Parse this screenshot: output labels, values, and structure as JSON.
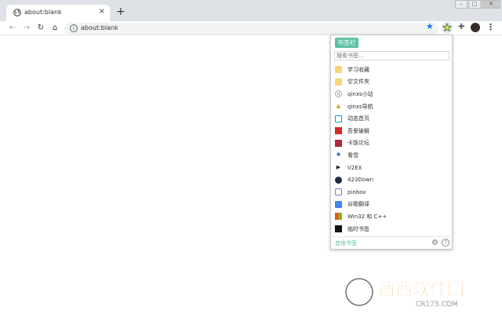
{
  "tab": {
    "title": "about:blank",
    "close": "×"
  },
  "newtab": "+",
  "window_buttons": [
    "–",
    "□",
    "✕"
  ],
  "nav": {
    "back": "←",
    "forward": "→",
    "reload": "↻",
    "home": "⌂"
  },
  "omnibox": {
    "info": "i",
    "url": "about:blank"
  },
  "toolbar_icons": {
    "star": "★",
    "puzzle": "✚",
    "menu": "⋮"
  },
  "popup": {
    "header": "书签栏",
    "search_placeholder": "搜索书签...",
    "items": [
      {
        "label": "学习收藏",
        "icon": "folder-icon"
      },
      {
        "label": "空文件夹",
        "icon": "folder-icon"
      },
      {
        "label": "qinxs小站",
        "icon": "q-site-icon"
      },
      {
        "label": "qinxs导航",
        "icon": "rocket-icon"
      },
      {
        "label": "动态首页",
        "icon": "tv-icon"
      },
      {
        "label": "吾爱破解",
        "icon": "grid-icon"
      },
      {
        "label": "卡饭论坛",
        "icon": "kafan-icon"
      },
      {
        "label": "看雪",
        "icon": "snowflake-icon"
      },
      {
        "label": "V2EX",
        "icon": "v2ex-icon"
      },
      {
        "label": "423Down",
        "icon": "down-icon"
      },
      {
        "label": "pinbox",
        "icon": "pinbox-icon"
      },
      {
        "label": "谷歌翻译",
        "icon": "translate-icon"
      },
      {
        "label": "Win32 和 C++",
        "icon": "windows-icon"
      },
      {
        "label": "临时书签",
        "icon": "bookmark-icon"
      }
    ],
    "footer": {
      "other": "其他书签",
      "gear": "⚙",
      "help": "?"
    }
  },
  "watermark": {
    "text": "西西软件园",
    "sub": "CR173.COM"
  },
  "colors": {
    "accent": "#5cbfa4",
    "star": "#1a73e8",
    "tabstrip": "#dee1e6"
  }
}
